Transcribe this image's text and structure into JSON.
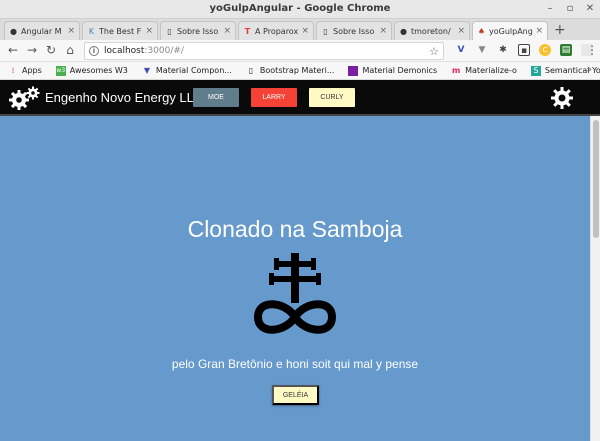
{
  "window": {
    "title": "yoGulpAngular - Google Chrome"
  },
  "tabs": [
    {
      "label": "Angular M",
      "icon": "github-icon"
    },
    {
      "label": "The Best F",
      "icon": "site-icon"
    },
    {
      "label": "Sobre Isso",
      "icon": "page-icon"
    },
    {
      "label": "A Proparox",
      "icon": "t-logo-icon"
    },
    {
      "label": "Sobre Isso",
      "icon": "page-icon"
    },
    {
      "label": "tmoreton/",
      "icon": "github-icon"
    },
    {
      "label": "yoGulpAng",
      "icon": "yeoman-icon"
    }
  ],
  "address": {
    "host": "localhost",
    "path": ":3000/#/"
  },
  "bookmarks": [
    {
      "label": "Apps",
      "icon": "apps-grid-icon"
    },
    {
      "label": "Awesomes W3",
      "icon": "w3-icon"
    },
    {
      "label": "Material Compon...",
      "icon": "material-icon"
    },
    {
      "label": "Bootstrap Materi...",
      "icon": "page-icon"
    },
    {
      "label": "Material Demonics",
      "icon": "purple-square-icon"
    },
    {
      "label": "Materialize-o",
      "icon": "materialize-icon"
    },
    {
      "label": "Semantical You",
      "icon": "s-icon"
    }
  ],
  "app": {
    "brand": "Engenho Novo Energy LLC",
    "buttons": {
      "moe": "MOE",
      "larry": "LARRY",
      "curly": "CURLY"
    },
    "heading": "Clonado na Samboja",
    "subtitle": "pelo Gran Bretônio e honi soit qui mal y pense",
    "cta": "GELÉIA"
  },
  "colors": {
    "background": "#6699cc",
    "navbar": "#0a0a0a",
    "moe": "#607d8b",
    "larry": "#f44336",
    "curly": "#fff9c4"
  }
}
